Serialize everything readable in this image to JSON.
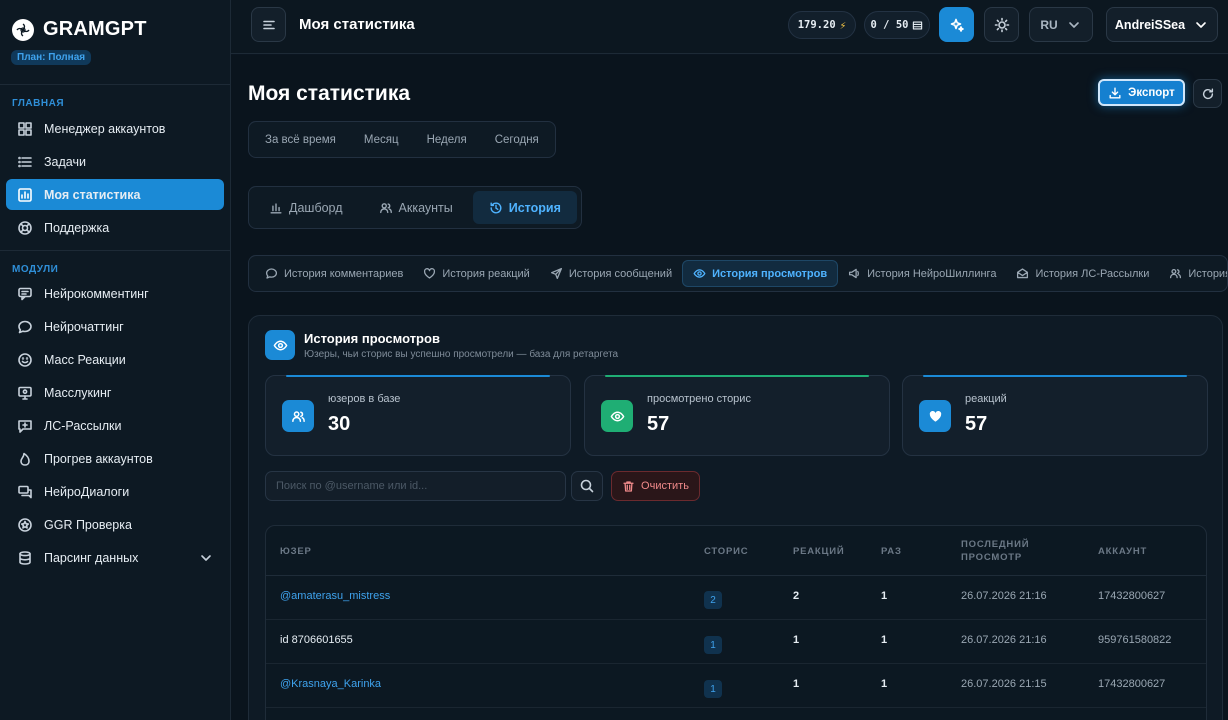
{
  "brand": {
    "name": "GRAMGPT",
    "plan": "План: Полная"
  },
  "sidebar": {
    "section_main": "ГЛАВНАЯ",
    "section_modules": "МОДУЛИ",
    "main_items": [
      {
        "label": "Менеджер аккаунтов",
        "icon": "grid-icon"
      },
      {
        "label": "Задачи",
        "icon": "list-icon"
      },
      {
        "label": "Моя статистика",
        "icon": "chart-icon",
        "active": true
      },
      {
        "label": "Поддержка",
        "icon": "lifebuoy-icon"
      }
    ],
    "module_items": [
      {
        "label": "Нейрокомментинг",
        "icon": "comments-icon"
      },
      {
        "label": "Нейрочаттинг",
        "icon": "chat-bubble-icon"
      },
      {
        "label": "Масс Реакции",
        "icon": "smiley-icon"
      },
      {
        "label": "Масслукинг",
        "icon": "monitor-eye-icon"
      },
      {
        "label": "ЛС-Рассылки",
        "icon": "message-plus-icon"
      },
      {
        "label": "Прогрев аккаунтов",
        "icon": "flame-icon"
      },
      {
        "label": "НейроДиалоги",
        "icon": "dialogs-icon"
      },
      {
        "label": "GGR Проверка",
        "icon": "star-circle-icon"
      },
      {
        "label": "Парсинг данных",
        "icon": "database-icon"
      }
    ]
  },
  "topbar": {
    "title": "Моя статистика",
    "balance": "179.20",
    "quota": "0 / 50",
    "language": "RU",
    "username": "AndreiSSea"
  },
  "page": {
    "title": "Моя статистика",
    "export_label": "Экспорт",
    "periods": [
      "За всё время",
      "Месяц",
      "Неделя",
      "Сегодня"
    ],
    "views": [
      "Дашборд",
      "Аккаунты",
      "История"
    ],
    "active_view": "История",
    "history_tabs": [
      "История комментариев",
      "История реакций",
      "История сообщений",
      "История просмотров",
      "История НейроШиллинга",
      "История ЛС-Рассылки",
      "История Спа"
    ],
    "active_history_tab": "История просмотров"
  },
  "card": {
    "title": "История просмотров",
    "subtitle": "Юзеры, чьи сторис вы успешно просмотрели — база для ретаргета",
    "stats": [
      {
        "label": "юзеров в базе",
        "value": "30",
        "color": "#1b8ad6"
      },
      {
        "label": "просмотрено сторис",
        "value": "57",
        "color": "#1fae74"
      },
      {
        "label": "реакций",
        "value": "57",
        "color": "#1b8ad6"
      }
    ],
    "search_placeholder": "Поиск по @username или id...",
    "clear_label": "Очистить"
  },
  "table": {
    "columns": [
      "ЮЗЕР",
      "СТОРИС",
      "РЕАКЦИЙ",
      "РАЗ",
      "ПОСЛЕДНИЙ ПРОСМОТР",
      "АККАУНТ"
    ],
    "rows": [
      {
        "user": "@amaterasu_mistress",
        "link": true,
        "stories": "2",
        "reactions": "2",
        "times": "1",
        "last_view": "26.07.2026 21:16",
        "account": "17432800627"
      },
      {
        "user": "id 8706601655",
        "link": false,
        "stories": "1",
        "reactions": "1",
        "times": "1",
        "last_view": "26.07.2026 21:16",
        "account": "959761580822"
      },
      {
        "user": "@Krasnaya_Karinka",
        "link": true,
        "stories": "1",
        "reactions": "1",
        "times": "1",
        "last_view": "26.07.2026 21:15",
        "account": "17432800627"
      }
    ]
  }
}
